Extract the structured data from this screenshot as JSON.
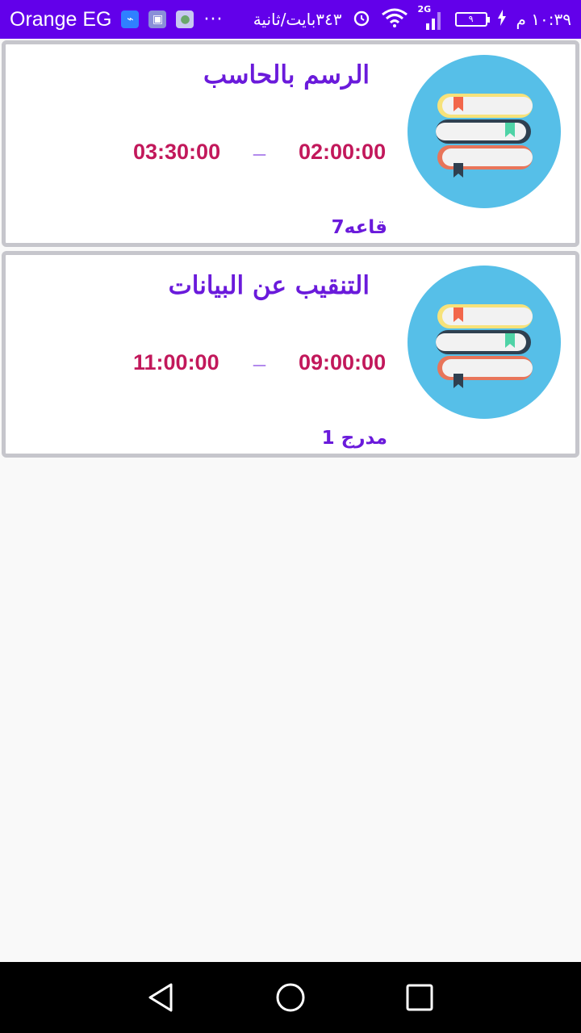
{
  "status_bar": {
    "carrier": "Orange EG",
    "dots": "···",
    "network_speed": "٣٤٣بايت/ثانية",
    "network_type": "2G",
    "battery_level": "٩",
    "time": "١٠:٣٩ م"
  },
  "lectures": [
    {
      "title": "الرسم بالحاسب",
      "start_time": "02:00:00",
      "separator": "_",
      "end_time": "03:30:00",
      "room": "قاعه7",
      "icon": "books-icon"
    },
    {
      "title": "التنقيب عن البيانات",
      "start_time": "09:00:00",
      "separator": "_",
      "end_time": "11:00:00",
      "room": "مدرج 1",
      "icon": "books-icon"
    }
  ],
  "colors": {
    "status_bar": "#6200ea",
    "title": "#6a1adb",
    "time": "#c2185b",
    "card_border": "#c6c6cc",
    "icon_circle": "#56bfe8"
  },
  "nav_bar": {
    "back_icon": "back-triangle-icon",
    "home_icon": "home-circle-icon",
    "recent_icon": "recent-square-icon"
  }
}
